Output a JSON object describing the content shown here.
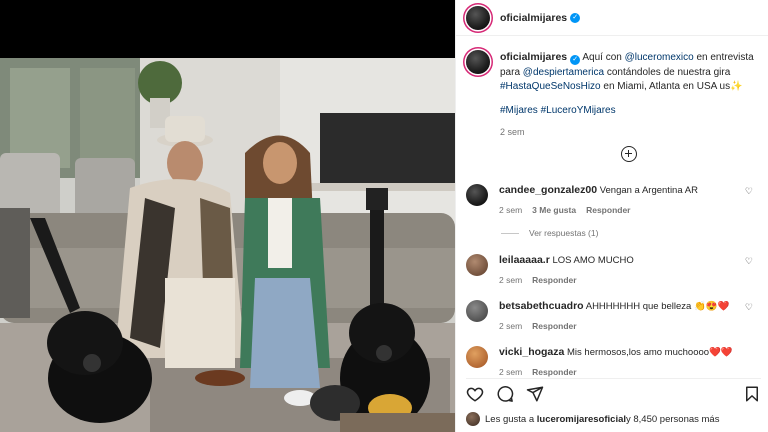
{
  "header": {
    "username": "oficialmijares"
  },
  "caption": {
    "username": "oficialmijares",
    "pre": "Aquí con ",
    "mention1": "@luceromexico",
    "mid1": " en entrevista para ",
    "mention2": "@despiertamerica",
    "mid2": " contándoles de nuestra gira ",
    "hashtag1": "#HastaQueSeNosHizo",
    "post": " en Miami, Atlanta en USA us✨",
    "tags": "#Mijares #LuceroYMijares",
    "time": "2 sem"
  },
  "comments": [
    {
      "username": "candee_gonzalez00",
      "text": "Vengan a Argentina AR",
      "time": "2 sem",
      "likes": "3 Me gusta",
      "reply": "Responder"
    },
    {
      "username": "leilaaaaa.r",
      "text": "LOS AMO MUCHO",
      "time": "2 sem",
      "reply": "Responder"
    },
    {
      "username": "betsabethcuadro",
      "text": "AHHHHHHH que belleza 👏😍❤️",
      "time": "2 sem",
      "reply": "Responder"
    },
    {
      "username": "vicki_hogaza",
      "text": "Mis hermosos,los amo muchoooo❤️❤️",
      "time": "2 sem",
      "reply": "Responder"
    }
  ],
  "view_replies": "Ver respuestas (1)",
  "likes": {
    "prefix": "Les gusta a ",
    "user": "luceromijaresoficial",
    "suffix": " y 8,450 personas más"
  },
  "icons": [
    "like-icon",
    "comment-icon",
    "share-icon",
    "save-icon",
    "add-comments-icon",
    "verified-icon",
    "heart-icon"
  ],
  "colors": {
    "link": "#00376b",
    "verified": "#0095f6",
    "heart": "#ed4956",
    "muted": "#737373"
  }
}
